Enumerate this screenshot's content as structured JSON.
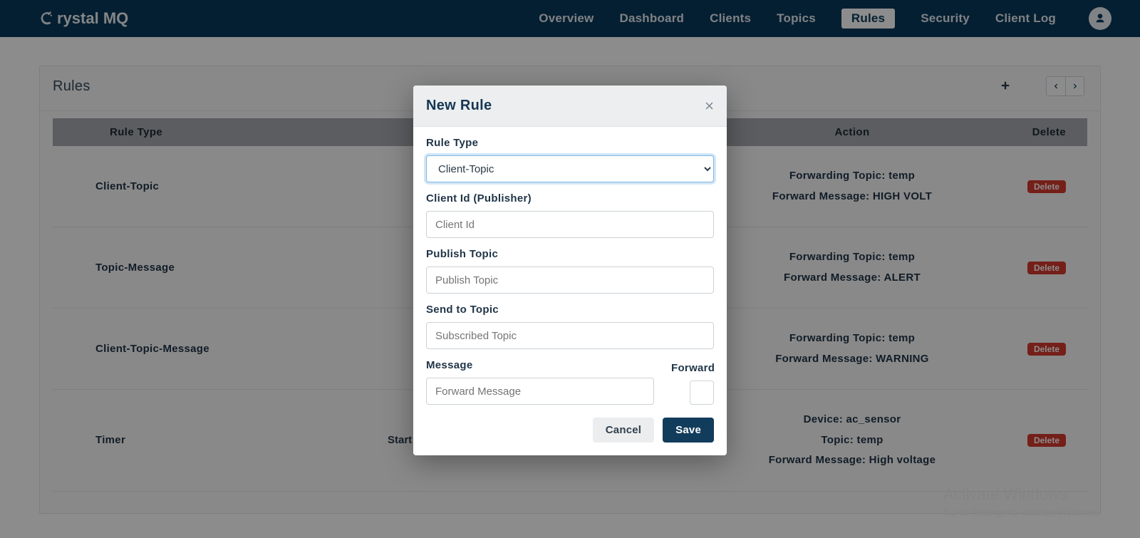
{
  "logo_text": "rystal MQ",
  "nav": {
    "overview": "Overview",
    "dashboard": "Dashboard",
    "clients": "Clients",
    "topics": "Topics",
    "rules": "Rules",
    "security": "Security",
    "clientlog": "Client Log"
  },
  "page": {
    "title": "Rules"
  },
  "table": {
    "headers": {
      "rule_type": "Rule Type",
      "action": "Action",
      "delete": "Delete"
    },
    "rows": [
      {
        "type": "Client-Topic",
        "cond": "",
        "line1": "Forwarding Topic: temp",
        "line2": "Forward Message: HIGH VOLT",
        "delete": "Delete"
      },
      {
        "type": "Topic-Message",
        "cond": "",
        "line1": "Forwarding Topic: temp",
        "line2": "Forward Message: ALERT",
        "delete": "Delete"
      },
      {
        "type": "Client-Topic-Message",
        "cond": "",
        "line1": "Forwarding Topic: temp",
        "line2": "Forward Message: WARNING",
        "delete": "Delete"
      },
      {
        "type": "Timer",
        "cond": "Start Dat",
        "line1": "Device: ac_sensor",
        "line2": "Topic: temp",
        "line3": "Forward Message: High voltage",
        "delete": "Delete"
      }
    ]
  },
  "modal": {
    "title": "New Rule",
    "labels": {
      "rule_type": "Rule Type",
      "client_id": "Client Id (Publisher)",
      "publish_topic": "Publish Topic",
      "send_to_topic": "Send to Topic",
      "message": "Message",
      "forward": "Forward"
    },
    "values": {
      "rule_type_selected": "Client-Topic"
    },
    "placeholders": {
      "client_id": "Client Id",
      "publish_topic": "Publish Topic",
      "send_to_topic": "Subscribed Topic",
      "message": "Forward Message"
    },
    "buttons": {
      "cancel": "Cancel",
      "save": "Save"
    }
  },
  "watermark": {
    "line1": "Activate Windows",
    "line2": "Go to Settings to activate Windows."
  }
}
